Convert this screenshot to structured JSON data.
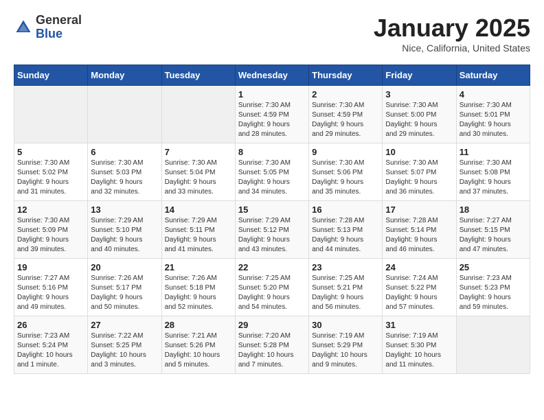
{
  "header": {
    "logo_general": "General",
    "logo_blue": "Blue",
    "month": "January 2025",
    "location": "Nice, California, United States"
  },
  "weekdays": [
    "Sunday",
    "Monday",
    "Tuesday",
    "Wednesday",
    "Thursday",
    "Friday",
    "Saturday"
  ],
  "weeks": [
    [
      {
        "day": "",
        "info": ""
      },
      {
        "day": "",
        "info": ""
      },
      {
        "day": "",
        "info": ""
      },
      {
        "day": "1",
        "info": "Sunrise: 7:30 AM\nSunset: 4:59 PM\nDaylight: 9 hours\nand 28 minutes."
      },
      {
        "day": "2",
        "info": "Sunrise: 7:30 AM\nSunset: 4:59 PM\nDaylight: 9 hours\nand 29 minutes."
      },
      {
        "day": "3",
        "info": "Sunrise: 7:30 AM\nSunset: 5:00 PM\nDaylight: 9 hours\nand 29 minutes."
      },
      {
        "day": "4",
        "info": "Sunrise: 7:30 AM\nSunset: 5:01 PM\nDaylight: 9 hours\nand 30 minutes."
      }
    ],
    [
      {
        "day": "5",
        "info": "Sunrise: 7:30 AM\nSunset: 5:02 PM\nDaylight: 9 hours\nand 31 minutes."
      },
      {
        "day": "6",
        "info": "Sunrise: 7:30 AM\nSunset: 5:03 PM\nDaylight: 9 hours\nand 32 minutes."
      },
      {
        "day": "7",
        "info": "Sunrise: 7:30 AM\nSunset: 5:04 PM\nDaylight: 9 hours\nand 33 minutes."
      },
      {
        "day": "8",
        "info": "Sunrise: 7:30 AM\nSunset: 5:05 PM\nDaylight: 9 hours\nand 34 minutes."
      },
      {
        "day": "9",
        "info": "Sunrise: 7:30 AM\nSunset: 5:06 PM\nDaylight: 9 hours\nand 35 minutes."
      },
      {
        "day": "10",
        "info": "Sunrise: 7:30 AM\nSunset: 5:07 PM\nDaylight: 9 hours\nand 36 minutes."
      },
      {
        "day": "11",
        "info": "Sunrise: 7:30 AM\nSunset: 5:08 PM\nDaylight: 9 hours\nand 37 minutes."
      }
    ],
    [
      {
        "day": "12",
        "info": "Sunrise: 7:30 AM\nSunset: 5:09 PM\nDaylight: 9 hours\nand 39 minutes."
      },
      {
        "day": "13",
        "info": "Sunrise: 7:29 AM\nSunset: 5:10 PM\nDaylight: 9 hours\nand 40 minutes."
      },
      {
        "day": "14",
        "info": "Sunrise: 7:29 AM\nSunset: 5:11 PM\nDaylight: 9 hours\nand 41 minutes."
      },
      {
        "day": "15",
        "info": "Sunrise: 7:29 AM\nSunset: 5:12 PM\nDaylight: 9 hours\nand 43 minutes."
      },
      {
        "day": "16",
        "info": "Sunrise: 7:28 AM\nSunset: 5:13 PM\nDaylight: 9 hours\nand 44 minutes."
      },
      {
        "day": "17",
        "info": "Sunrise: 7:28 AM\nSunset: 5:14 PM\nDaylight: 9 hours\nand 46 minutes."
      },
      {
        "day": "18",
        "info": "Sunrise: 7:27 AM\nSunset: 5:15 PM\nDaylight: 9 hours\nand 47 minutes."
      }
    ],
    [
      {
        "day": "19",
        "info": "Sunrise: 7:27 AM\nSunset: 5:16 PM\nDaylight: 9 hours\nand 49 minutes."
      },
      {
        "day": "20",
        "info": "Sunrise: 7:26 AM\nSunset: 5:17 PM\nDaylight: 9 hours\nand 50 minutes."
      },
      {
        "day": "21",
        "info": "Sunrise: 7:26 AM\nSunset: 5:18 PM\nDaylight: 9 hours\nand 52 minutes."
      },
      {
        "day": "22",
        "info": "Sunrise: 7:25 AM\nSunset: 5:20 PM\nDaylight: 9 hours\nand 54 minutes."
      },
      {
        "day": "23",
        "info": "Sunrise: 7:25 AM\nSunset: 5:21 PM\nDaylight: 9 hours\nand 56 minutes."
      },
      {
        "day": "24",
        "info": "Sunrise: 7:24 AM\nSunset: 5:22 PM\nDaylight: 9 hours\nand 57 minutes."
      },
      {
        "day": "25",
        "info": "Sunrise: 7:23 AM\nSunset: 5:23 PM\nDaylight: 9 hours\nand 59 minutes."
      }
    ],
    [
      {
        "day": "26",
        "info": "Sunrise: 7:23 AM\nSunset: 5:24 PM\nDaylight: 10 hours\nand 1 minute."
      },
      {
        "day": "27",
        "info": "Sunrise: 7:22 AM\nSunset: 5:25 PM\nDaylight: 10 hours\nand 3 minutes."
      },
      {
        "day": "28",
        "info": "Sunrise: 7:21 AM\nSunset: 5:26 PM\nDaylight: 10 hours\nand 5 minutes."
      },
      {
        "day": "29",
        "info": "Sunrise: 7:20 AM\nSunset: 5:28 PM\nDaylight: 10 hours\nand 7 minutes."
      },
      {
        "day": "30",
        "info": "Sunrise: 7:19 AM\nSunset: 5:29 PM\nDaylight: 10 hours\nand 9 minutes."
      },
      {
        "day": "31",
        "info": "Sunrise: 7:19 AM\nSunset: 5:30 PM\nDaylight: 10 hours\nand 11 minutes."
      },
      {
        "day": "",
        "info": ""
      }
    ]
  ]
}
